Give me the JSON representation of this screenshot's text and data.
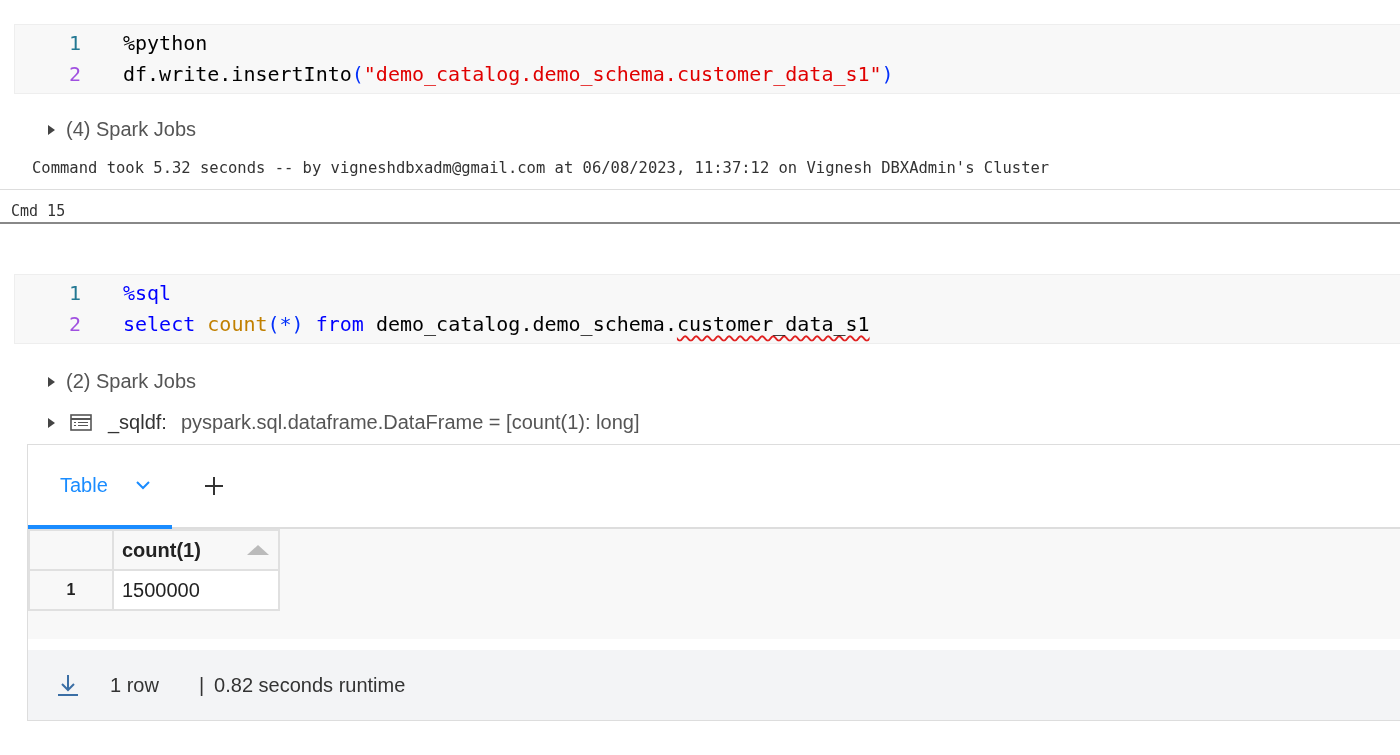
{
  "cell_top": {
    "code": [
      {
        "number": "1",
        "tokens": [
          {
            "kind": "plain",
            "text": "%python"
          }
        ]
      },
      {
        "number": "2",
        "tokens": [
          {
            "kind": "plain",
            "text": "df.write.insertInto"
          },
          {
            "kind": "bracket",
            "text": "("
          },
          {
            "kind": "string",
            "text": "\"demo_catalog.demo_schema.customer_data_s1\""
          },
          {
            "kind": "bracket",
            "text": ")"
          }
        ]
      }
    ],
    "spark_jobs": {
      "label": "(4) Spark Jobs",
      "expanded": false
    },
    "command_info": "Command took 5.32 seconds -- by vigneshdbxadm@gmail.com at 06/08/2023, 11:37:12 on Vignesh DBXAdmin's Cluster"
  },
  "cmd_label": "Cmd 15",
  "cell_bottom": {
    "code": [
      {
        "number": "1",
        "tokens": [
          {
            "kind": "keyword",
            "text": "%sql"
          }
        ]
      },
      {
        "number": "2",
        "tokens": [
          {
            "kind": "keyword",
            "text": "select "
          },
          {
            "kind": "function",
            "text": "count"
          },
          {
            "kind": "bracket",
            "text": "(*) "
          },
          {
            "kind": "keyword",
            "text": "from "
          },
          {
            "kind": "plain",
            "text": "demo_catalog.demo_schema."
          },
          {
            "kind": "flagged",
            "text": "customer_data_s1"
          }
        ]
      }
    ],
    "spark_jobs": {
      "label": "(2) Spark Jobs",
      "expanded": false
    },
    "dataframe": {
      "name": "_sqldf:",
      "schema": "pyspark.sql.dataframe.DataFrame = [count(1): long]",
      "expanded": false
    },
    "results": {
      "tabs": [
        {
          "label": "Table",
          "selected": true
        }
      ],
      "table": {
        "columns": [
          "count(1)"
        ],
        "rows": [
          {
            "index": "1",
            "cells": [
              "1500000"
            ]
          }
        ]
      },
      "footer": {
        "row_count": "1 row",
        "separator": "|",
        "runtime": "0.82 seconds runtime"
      }
    }
  }
}
